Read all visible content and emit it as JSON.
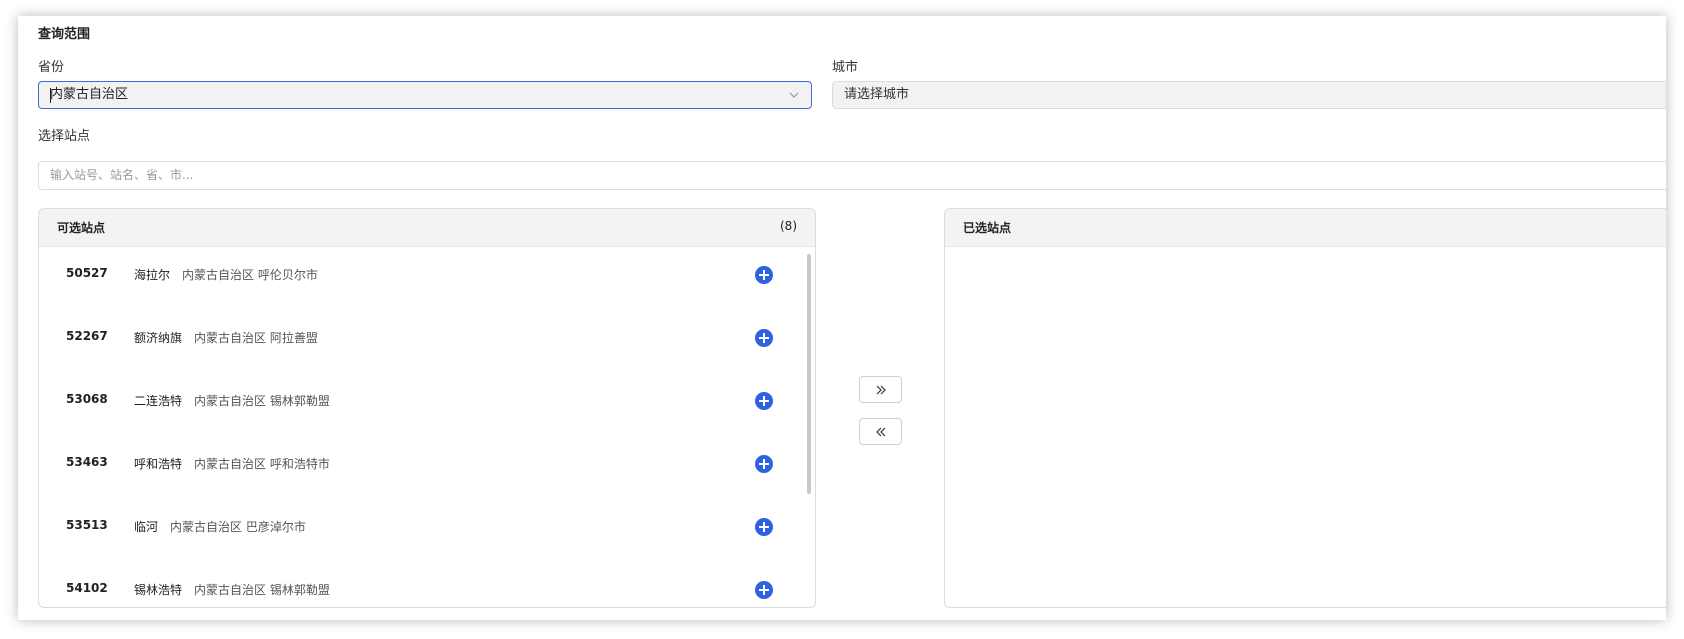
{
  "query": {
    "section_title": "查询范围",
    "province": {
      "label": "省份",
      "value": "内蒙古自治区"
    },
    "city": {
      "label": "城市",
      "placeholder": "请选择城市"
    },
    "station": {
      "label": "选择站点",
      "placeholder": "输入站号、站名、省、市..."
    }
  },
  "available": {
    "title": "可选站点",
    "count": "(8)",
    "items": [
      {
        "code": "50527",
        "name": "海拉尔",
        "region": "内蒙古自治区 呼伦贝尔市"
      },
      {
        "code": "52267",
        "name": "额济纳旗",
        "region": "内蒙古自治区 阿拉善盟"
      },
      {
        "code": "53068",
        "name": "二连浩特",
        "region": "内蒙古自治区 锡林郭勒盟"
      },
      {
        "code": "53463",
        "name": "呼和浩特",
        "region": "内蒙古自治区 呼和浩特市"
      },
      {
        "code": "53513",
        "name": "临河",
        "region": "内蒙古自治区 巴彦淖尔市"
      },
      {
        "code": "54102",
        "name": "锡林浩特",
        "region": "内蒙古自治区 锡林郭勒盟"
      }
    ]
  },
  "selected": {
    "title": "已选站点"
  },
  "icons": {
    "add": "plus-circle-icon",
    "move_right": "double-chevron-right-icon",
    "move_left": "double-chevron-left-icon",
    "dropdown": "chevron-down-icon"
  },
  "colors": {
    "accent": "#2f62e0",
    "focus_border": "#3b6fd8"
  }
}
